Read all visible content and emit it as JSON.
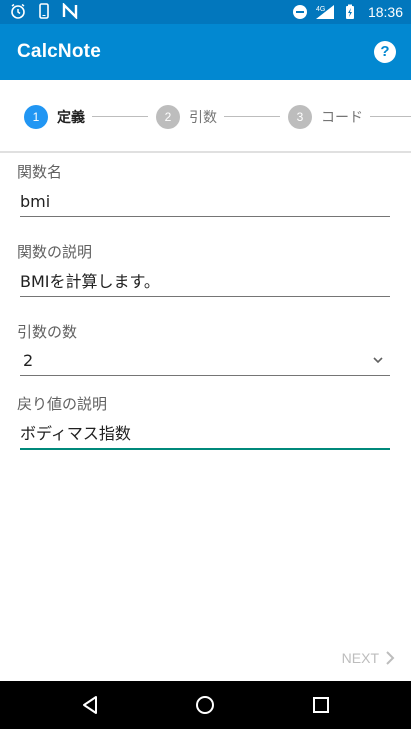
{
  "status_bar": {
    "time": "18:36",
    "network": "4G",
    "icons": [
      "alarm-icon",
      "phone-icon",
      "n-app-icon",
      "do-not-disturb-icon",
      "signal-icon",
      "battery-icon"
    ]
  },
  "app_bar": {
    "title": "CalcNote",
    "help_icon": "?"
  },
  "stepper": {
    "steps": [
      {
        "number": "1",
        "label": "定義",
        "active": true
      },
      {
        "number": "2",
        "label": "引数",
        "active": false
      },
      {
        "number": "3",
        "label": "コード",
        "active": false
      }
    ]
  },
  "form": {
    "name_label": "関数名",
    "name_value": "bmi",
    "description_label": "関数の説明",
    "description_value": "BMIを計算します。",
    "arg_count_label": "引数の数",
    "arg_count_value": "2",
    "return_label": "戻り値の説明",
    "return_value": "ボディマス指数"
  },
  "footer": {
    "next_label": "NEXT"
  },
  "colors": {
    "status_bar": "#0277bd",
    "app_bar": "#0288d1",
    "step_active": "#2196f3",
    "step_inactive": "#bdbdbd",
    "focus_underline": "#00897b"
  }
}
